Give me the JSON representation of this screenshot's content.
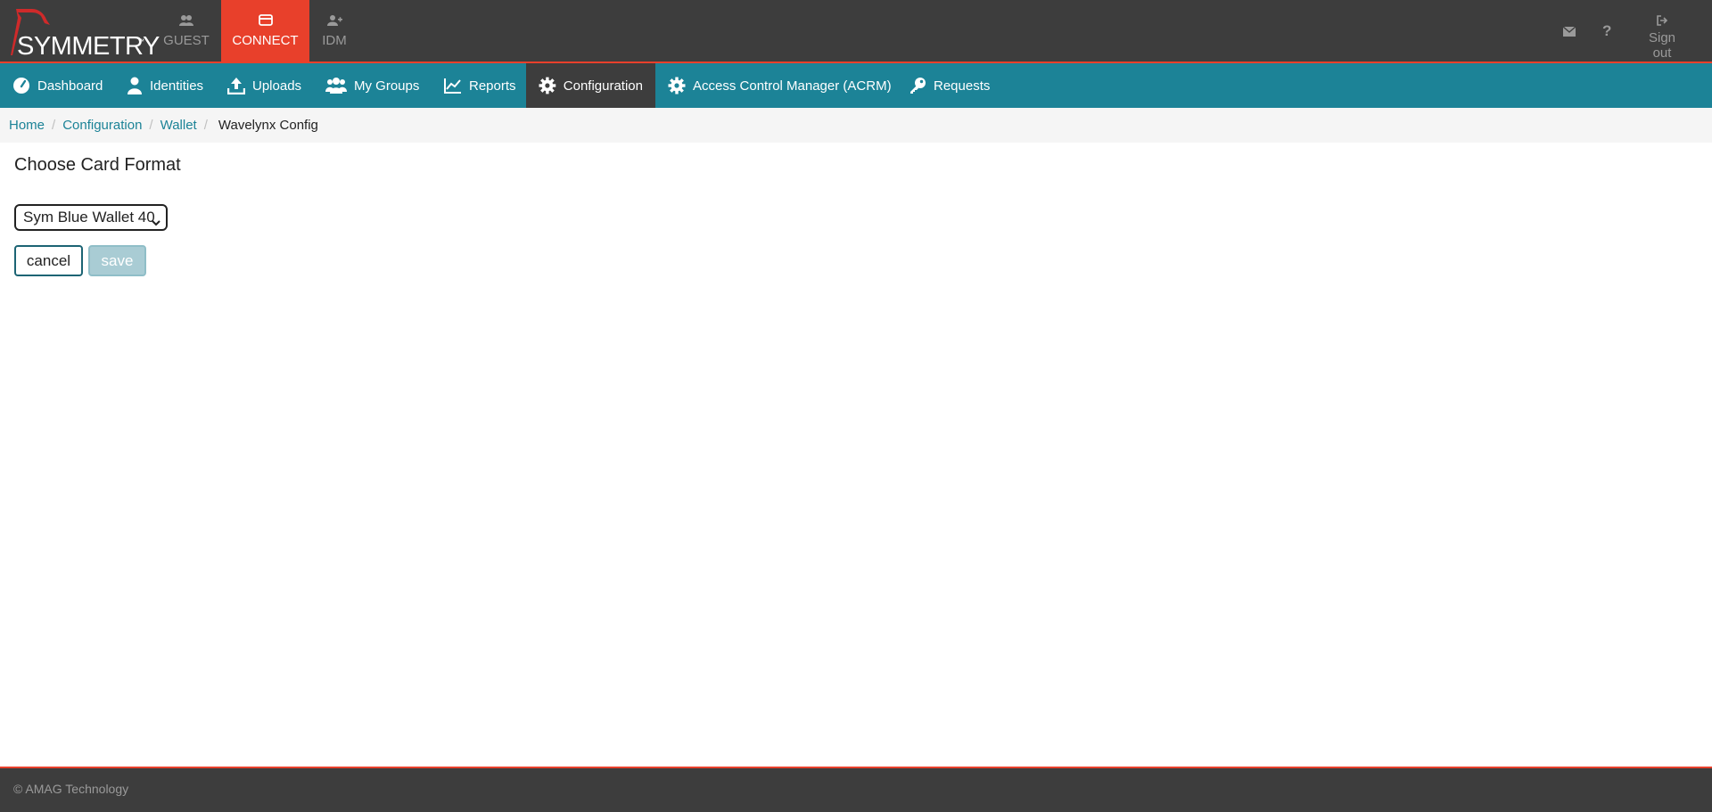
{
  "header": {
    "logo_text": "SYMMETRY",
    "logo_tm": "™",
    "app_tabs": [
      {
        "label": "GUEST",
        "icon": "group-icon",
        "active": false
      },
      {
        "label": "CONNECT",
        "icon": "card-icon",
        "active": true
      },
      {
        "label": "IDM",
        "icon": "user-plus-icon",
        "active": false
      }
    ],
    "mail_icon": "envelope-icon",
    "help_icon": "question-icon",
    "signout_label": "Sign out",
    "signout_icon": "sign-out-icon"
  },
  "nav": {
    "items": [
      {
        "label": "Dashboard",
        "icon": "dashboard-icon",
        "active": false
      },
      {
        "label": "Identities",
        "icon": "user-icon",
        "active": false
      },
      {
        "label": "Uploads",
        "icon": "upload-icon",
        "active": false
      },
      {
        "label": "My Groups",
        "icon": "users-icon",
        "active": false
      },
      {
        "label": "Reports",
        "icon": "line-chart-icon",
        "active": false
      },
      {
        "label": "Configuration",
        "icon": "gear-icon",
        "active": true
      },
      {
        "label": "Access Control Manager (ACRM)",
        "icon": "gear-icon",
        "active": false
      },
      {
        "label": "Requests",
        "icon": "key-icon",
        "active": false
      }
    ]
  },
  "breadcrumb": {
    "items": [
      "Home",
      "Configuration",
      "Wallet"
    ],
    "separator": "/",
    "current": "Wavelynx Config"
  },
  "main": {
    "title": "Choose Card Format",
    "card_format_selected": "Sym Blue Wallet 40",
    "cancel_label": "cancel",
    "save_label": "save"
  },
  "footer": {
    "copyright": "© AMAG Technology"
  },
  "colors": {
    "header_bg": "#3d3d3d",
    "accent_red": "#e8402b",
    "nav_teal": "#1c8397",
    "breadcrumb_bg": "#f5f5f5"
  }
}
